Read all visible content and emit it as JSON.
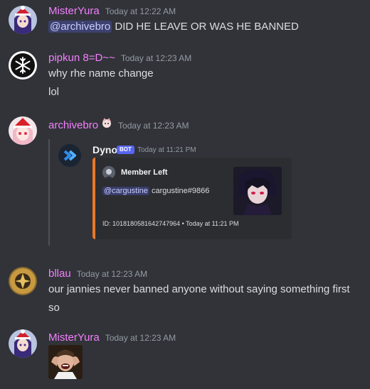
{
  "messages": [
    {
      "username": "MisterYura",
      "timestamp": "Today at 12:22 AM",
      "mention": "@archivebro",
      "text": " DID HE LEAVE OR WAS HE BANNED"
    },
    {
      "username": "pipkun 8=D~~",
      "timestamp": "Today at 12:23 AM",
      "lines": [
        "why rhe name change",
        "lol"
      ]
    },
    {
      "username": "archivebro",
      "timestamp": "Today at 12:23 AM",
      "badge_icon": "anime-girl-emoji"
    },
    {
      "username": "bllau",
      "timestamp": "Today at 12:23 AM",
      "lines": [
        "our jannies never banned anyone without saying something first",
        "so"
      ]
    },
    {
      "username": "MisterYura",
      "timestamp": "Today at 12:23 AM",
      "attachment": "laughing-man-image"
    }
  ],
  "embed": {
    "bot_name": "Dyno",
    "bot_tag": "BOT",
    "bot_time": "Today at 11:21 PM",
    "author": "Member Left",
    "mention": "@cargustine",
    "desc_rest": " cargustine#9866",
    "footer": "ID: 1018180581642747964 • Today at 11:21 PM",
    "accent_color": "#e8782a"
  },
  "colors": {
    "background": "#313338",
    "username_pink": "#f47fff",
    "mention_bg": "#5865f2"
  }
}
